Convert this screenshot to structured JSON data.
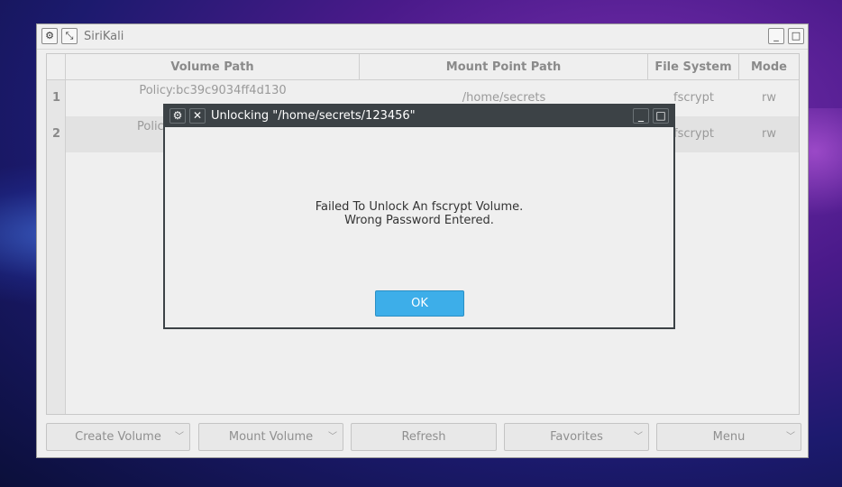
{
  "window": {
    "title": "SiriKali",
    "buttons": {
      "menu_glyph": "⚙",
      "pin_glyph": "⤡",
      "minimize_glyph": "_",
      "maximize_glyph": "□"
    }
  },
  "table": {
    "headers": [
      "Volume Path",
      "Mount Point Path",
      "File System",
      "Mode"
    ],
    "rows": [
      {
        "num": "1",
        "volume_line1": "Policy:bc39c9034ff4d130",
        "volume_line2": "...",
        "mount": "/home/secrets",
        "fs": "fscrypt",
        "mode": "rw"
      },
      {
        "num": "2",
        "volume_line1": "Polic",
        "mount": "",
        "fs": "fscrypt",
        "mode": "rw"
      }
    ]
  },
  "buttons": {
    "create_volume": "Create Volume",
    "mount_volume": "Mount Volume",
    "refresh": "Refresh",
    "favorites": "Favorites",
    "menu": "Menu",
    "chevron": "﹀"
  },
  "dialog": {
    "title": "Unlocking \"/home/secrets/123456\"",
    "message_line1": "Failed To Unlock An fscrypt Volume.",
    "message_line2": "Wrong Password Entered.",
    "ok": "OK",
    "menu_glyph": "⚙",
    "close_glyph": "✕",
    "minimize_glyph": "_",
    "maximize_glyph": "□"
  },
  "colors": {
    "accent": "#3daee9",
    "dialog_titlebar": "#3c4246"
  }
}
